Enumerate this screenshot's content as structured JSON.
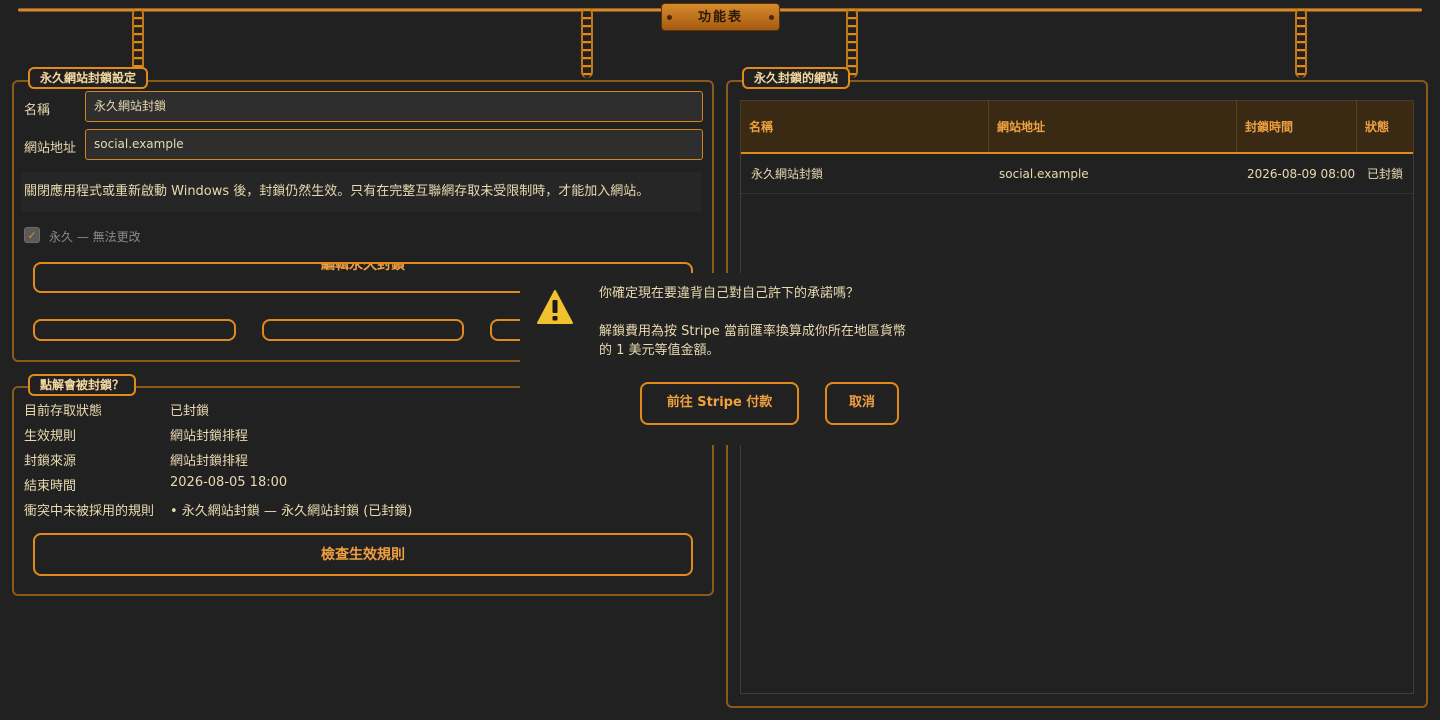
{
  "menu": {
    "title": "功能表"
  },
  "settings": {
    "legend": "永久網站封鎖設定",
    "name_label": "名稱",
    "name_value": "永久網站封鎖",
    "url_label": "網站地址",
    "url_value": "social.example",
    "note": "關閉應用程式或重新啟動 Windows 後，封鎖仍然生效。只有在完整互聯網存取未受限制時，才能加入網站。",
    "permanent_label": "永久 — 無法更改",
    "permanent_checked": true,
    "main_button": "編輯永久封鎖"
  },
  "why": {
    "legend": "點解會被封鎖？",
    "rows": [
      {
        "key": "目前存取狀態",
        "value": "已封鎖"
      },
      {
        "key": "生效規則",
        "value": "網站封鎖排程"
      },
      {
        "key": "封鎖來源",
        "value": "網站封鎖排程"
      },
      {
        "key": "結束時間",
        "value": "2026-08-05 18:00"
      },
      {
        "key": "衝突中未被採用的規則",
        "value": "• 永久網站封鎖 — 永久網站封鎖 (已封鎖)"
      }
    ],
    "check_button": "檢查生效規則"
  },
  "sites": {
    "legend": "永久封鎖的網站",
    "columns": [
      "名稱",
      "網站地址",
      "封鎖時間",
      "狀態"
    ],
    "rows": [
      {
        "name": "永久網站封鎖",
        "url": "social.example",
        "time": "2026-08-09 08:00",
        "status": "已封鎖"
      }
    ]
  },
  "dialog": {
    "question": "你確定現在要違背自己對自己許下的承諾嗎？",
    "body": "解鎖費用為按 Stripe 當前匯率換算成你所在地區貨幣的 1 美元等值金額。",
    "pay_button": "前往 Stripe 付款",
    "cancel_button": "取消",
    "icon": "warning-icon"
  },
  "colors": {
    "accent": "#e08a1c",
    "background": "#212121",
    "text": "#e8d9b0"
  }
}
